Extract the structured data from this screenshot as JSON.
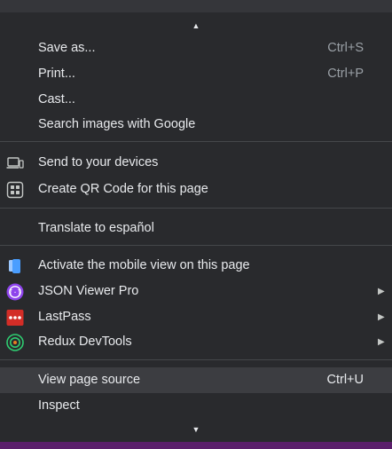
{
  "menu": {
    "scroll_up": "▲",
    "scroll_down": "▼",
    "items": [
      {
        "label": "Save as...",
        "shortcut": "Ctrl+S"
      },
      {
        "label": "Print...",
        "shortcut": "Ctrl+P"
      },
      {
        "label": "Cast..."
      },
      {
        "label": "Search images with Google"
      },
      {
        "label": "Send to your devices",
        "icon": "devices-icon"
      },
      {
        "label": "Create QR Code for this page",
        "icon": "qr-code-icon"
      },
      {
        "label": "Translate to español"
      },
      {
        "label": "Activate the mobile view on this page",
        "icon": "mobile-view-icon"
      },
      {
        "label": "JSON Viewer Pro",
        "icon": "json-viewer-icon",
        "submenu": "▶"
      },
      {
        "label": "LastPass",
        "icon": "lastpass-icon",
        "submenu": "▶"
      },
      {
        "label": "Redux DevTools",
        "icon": "redux-devtools-icon",
        "submenu": "▶"
      },
      {
        "label": "View page source",
        "shortcut": "Ctrl+U",
        "highlighted": true
      },
      {
        "label": "Inspect"
      }
    ]
  },
  "colors": {
    "menu_bg": "#292a2d",
    "highlight_bg": "#3c3d41",
    "text": "#e8eaed",
    "json_viewer": "#8e44ec",
    "lastpass": "#d32d27",
    "redux": "#2ecc71",
    "mobile": "#4a9eff"
  }
}
